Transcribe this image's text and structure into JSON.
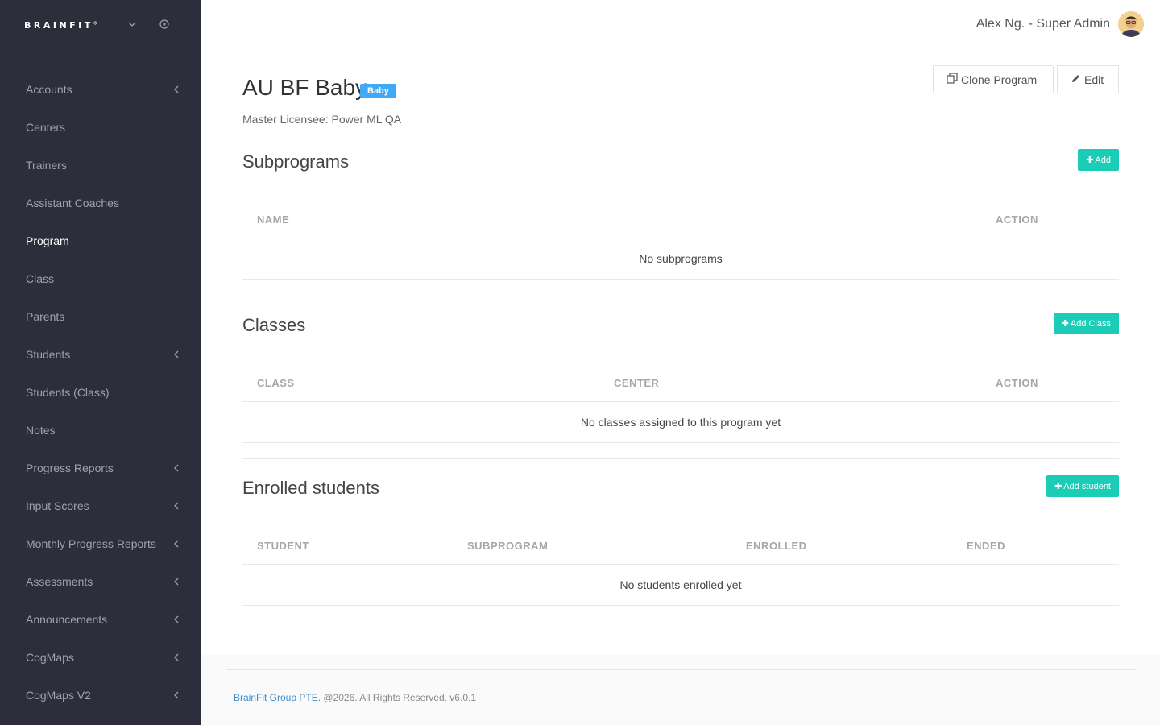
{
  "brand": {
    "logo": "BRAINFIT"
  },
  "header": {
    "user": "Alex Ng. - Super Admin"
  },
  "sidebar": {
    "items": [
      {
        "label": "Accounts",
        "has_sub": true,
        "active": false
      },
      {
        "label": "Centers",
        "has_sub": false,
        "active": false
      },
      {
        "label": "Trainers",
        "has_sub": false,
        "active": false
      },
      {
        "label": "Assistant Coaches",
        "has_sub": false,
        "active": false
      },
      {
        "label": "Program",
        "has_sub": false,
        "active": true
      },
      {
        "label": "Class",
        "has_sub": false,
        "active": false
      },
      {
        "label": "Parents",
        "has_sub": false,
        "active": false
      },
      {
        "label": "Students",
        "has_sub": true,
        "active": false
      },
      {
        "label": "Students (Class)",
        "has_sub": false,
        "active": false
      },
      {
        "label": "Notes",
        "has_sub": false,
        "active": false
      },
      {
        "label": "Progress Reports",
        "has_sub": true,
        "active": false
      },
      {
        "label": "Input Scores",
        "has_sub": true,
        "active": false
      },
      {
        "label": "Monthly Progress Reports",
        "has_sub": true,
        "active": false
      },
      {
        "label": "Assessments",
        "has_sub": true,
        "active": false
      },
      {
        "label": "Announcements",
        "has_sub": true,
        "active": false
      },
      {
        "label": "CogMaps",
        "has_sub": true,
        "active": false
      },
      {
        "label": "CogMaps V2",
        "has_sub": true,
        "active": false
      }
    ]
  },
  "program": {
    "title": "AU BF Baby",
    "badge": "Baby",
    "licensee": "Master Licensee: Power ML QA",
    "clone_label": "Clone Program",
    "edit_label": "Edit"
  },
  "subprograms": {
    "title": "Subprograms",
    "add_label": "Add",
    "columns": [
      "NAME",
      "ACTION"
    ],
    "empty": "No subprograms"
  },
  "classes": {
    "title": "Classes",
    "add_label": "Add Class",
    "columns": [
      "CLASS",
      "CENTER",
      "ACTION"
    ],
    "empty": "No classes assigned to this program yet"
  },
  "students": {
    "title": "Enrolled students",
    "add_label": "Add student",
    "columns": [
      "STUDENT",
      "SUBPROGRAM",
      "ENROLLED",
      "ENDED"
    ],
    "empty": "No students enrolled yet"
  },
  "footer": {
    "company": "BrainFit Group PTE.",
    "rights": " @2026. All Rights Reserved. v6.0.1"
  },
  "colors": {
    "sidebar": "#2c2f3b",
    "accent": "#1bcdb7",
    "badge": "#3fa9f5",
    "link": "#3a8ccf"
  },
  "icons": [
    "chevron-down-icon",
    "target-icon",
    "chevron-left-icon",
    "clone-icon",
    "pencil-icon",
    "plus-icon"
  ]
}
